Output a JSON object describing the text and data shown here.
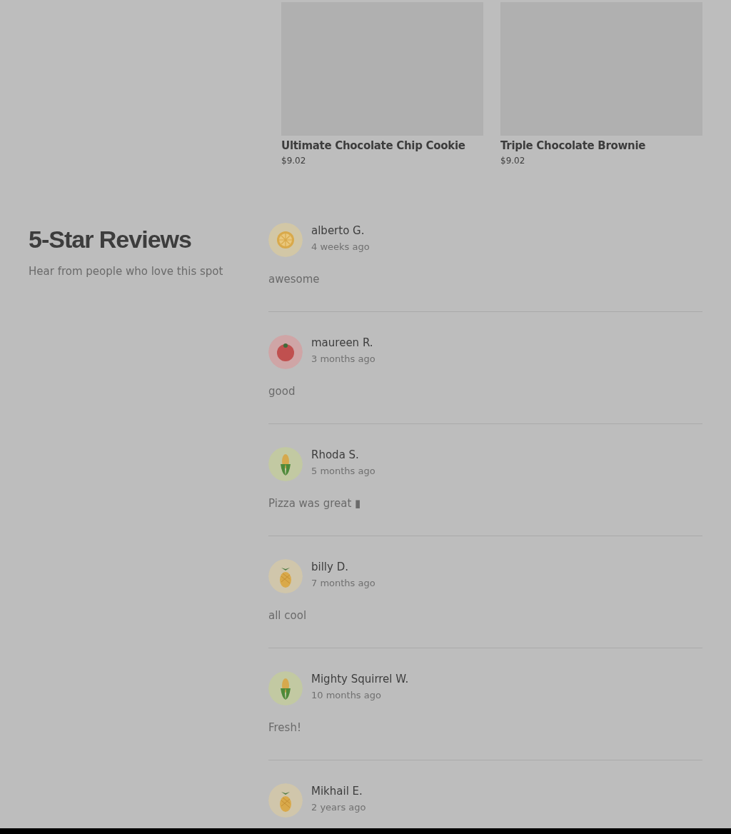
{
  "products": [
    {
      "name": "Ultimate Chocolate Chip Cookie",
      "price": "$9.02"
    },
    {
      "name": "Triple Chocolate Brownie",
      "price": "$9.02"
    }
  ],
  "reviews_section": {
    "title": "5-Star Reviews",
    "subtitle": "Hear from people who love this spot"
  },
  "reviews": [
    {
      "kind": "citrus",
      "name": "alberto G.",
      "time": "4 weeks ago",
      "text": "awesome"
    },
    {
      "kind": "tomato",
      "name": "maureen R.",
      "time": "3 months ago",
      "text": "good"
    },
    {
      "kind": "corn",
      "name": "Rhoda S.",
      "time": "5 months ago",
      "text": "Pizza was great ▮"
    },
    {
      "kind": "pineapple",
      "name": "billy D.",
      "time": "7 months ago",
      "text": "all cool"
    },
    {
      "kind": "corn",
      "name": "Mighty Squirrel W.",
      "time": "10 months ago",
      "text": "Fresh!"
    },
    {
      "kind": "pineapple",
      "name": "Mikhail E.",
      "time": "2 years ago"
    }
  ]
}
